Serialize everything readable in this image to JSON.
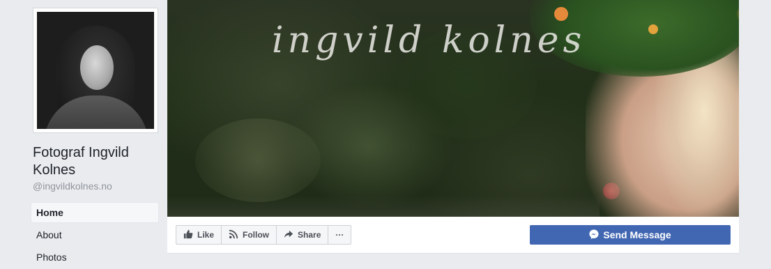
{
  "page": {
    "name": "Fotograf Ingvild Kolnes",
    "handle": "@ingvildkolnes.no"
  },
  "cover": {
    "script_text": "ingvild kolnes"
  },
  "nav": {
    "items": [
      {
        "label": "Home"
      },
      {
        "label": "About"
      },
      {
        "label": "Photos"
      }
    ]
  },
  "actions": {
    "like_label": "Like",
    "follow_label": "Follow",
    "share_label": "Share",
    "more_label": "···",
    "send_message_label": "Send Message"
  },
  "colors": {
    "brand_blue": "#4267b2",
    "background": "#e9ebee"
  },
  "icons": {
    "like": "thumbs-up-icon",
    "follow": "rss-icon",
    "share": "share-arrow-icon",
    "more": "ellipsis-icon",
    "messenger": "messenger-icon"
  }
}
